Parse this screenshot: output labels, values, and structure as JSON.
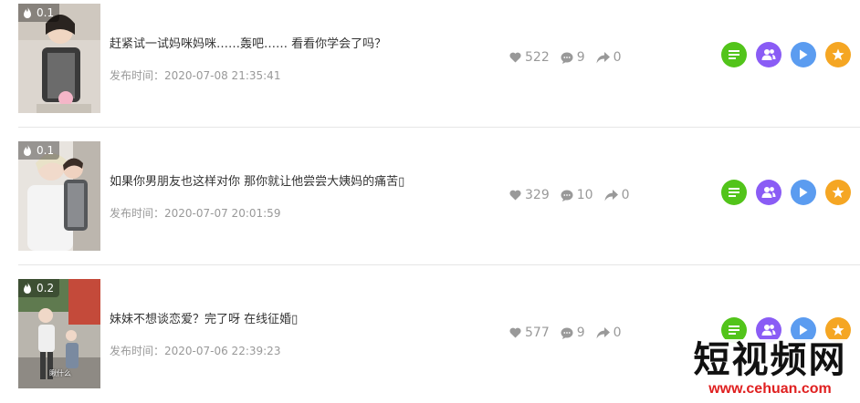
{
  "colors": {
    "green_button": "#52c41a",
    "purple_button": "#8a5cf5",
    "blue_button": "#5b9cf0",
    "orange_button": "#f5a623",
    "stat_gray": "#999999",
    "divider": "#e6e6e6"
  },
  "icons": {
    "heat": "flame-icon",
    "likes": "heart-icon",
    "comments": "comment-icon",
    "shares": "share-icon",
    "action_1": "list-icon",
    "action_2": "users-icon",
    "action_3": "play-icon",
    "action_4": "star-icon"
  },
  "videos": [
    {
      "heat": "0.1",
      "title": "赶紧试一试妈咪妈咪……轰吧…… 看看你学会了吗？",
      "publish_time": "发布时间：2020-07-08 21:35:41",
      "likes": "522",
      "comments": "9",
      "shares": "0"
    },
    {
      "heat": "0.1",
      "title": "如果你男朋友也这样对你 那你就让他尝尝大姨妈的痛苦▯",
      "publish_time": "发布时间：2020-07-07 20:01:59",
      "likes": "329",
      "comments": "10",
      "shares": "0"
    },
    {
      "heat": "0.2",
      "title": "妹妹不想谈恋爱？完了呀 在线征婚▯",
      "publish_time": "发布时间：2020-07-06 22:39:23",
      "likes": "577",
      "comments": "9",
      "shares": "0"
    }
  ],
  "thumbnail_caption": "瞅什么",
  "watermark": {
    "main": "短视频网",
    "sub": "www.cehuan.com"
  }
}
